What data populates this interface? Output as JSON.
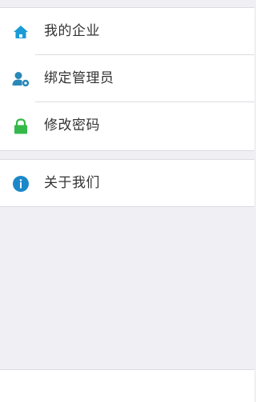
{
  "menu": {
    "items": [
      {
        "label": "我的企业",
        "icon": "home-icon",
        "color": "#1a9bd7"
      },
      {
        "label": "绑定管理员",
        "icon": "user-settings-icon",
        "color": "#2a88b8"
      },
      {
        "label": "修改密码",
        "icon": "lock-icon",
        "color": "#35b84a"
      }
    ],
    "about": {
      "label": "关于我们",
      "icon": "info-icon",
      "color": "#1a88c9"
    }
  },
  "colors": {
    "background": "#efeff4",
    "card": "#ffffff",
    "text": "#333333",
    "divider": "#dcdce0"
  }
}
